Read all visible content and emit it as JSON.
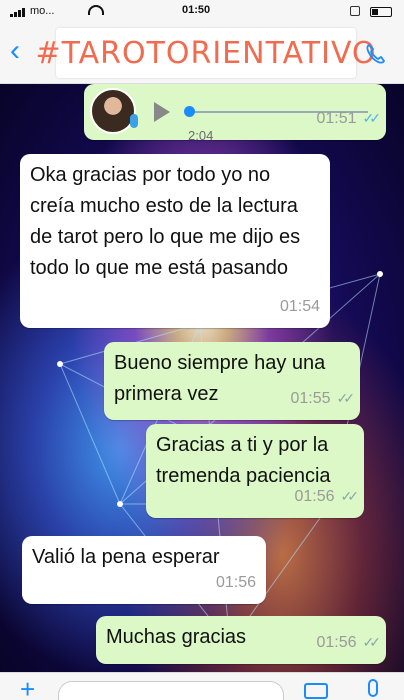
{
  "status": {
    "carrier": "mo...",
    "time": "01:50"
  },
  "header": {
    "title": "#TAROTORIENTATIVO"
  },
  "messages": [
    {
      "type": "voice",
      "duration": "2:04",
      "time": "01:51",
      "read": true
    },
    {
      "type": "in",
      "text": "Oka gracias por todo yo no creía mucho esto de la lectura de tarot pero lo que me dijo es todo lo que me está pasando",
      "time": "01:54"
    },
    {
      "type": "out",
      "text": "Bueno siempre hay una primera vez",
      "time": "01:55"
    },
    {
      "type": "out",
      "text": "Gracias a ti y por la tremenda paciencia",
      "time": "01:56"
    },
    {
      "type": "in",
      "text": "Valió la pena esperar",
      "time": "01:56"
    },
    {
      "type": "out",
      "text": "Muchas gracias",
      "time": "01:56"
    }
  ],
  "icons": {
    "back": "chevron-left-icon",
    "call": "phone-icon",
    "plus": "plus-icon",
    "camera": "camera-icon",
    "mic": "microphone-icon"
  },
  "colors": {
    "incoming": "#ffffff",
    "outgoing": "#dcf8c6",
    "accent": "#1a8cff",
    "title": "#f26b4f"
  }
}
